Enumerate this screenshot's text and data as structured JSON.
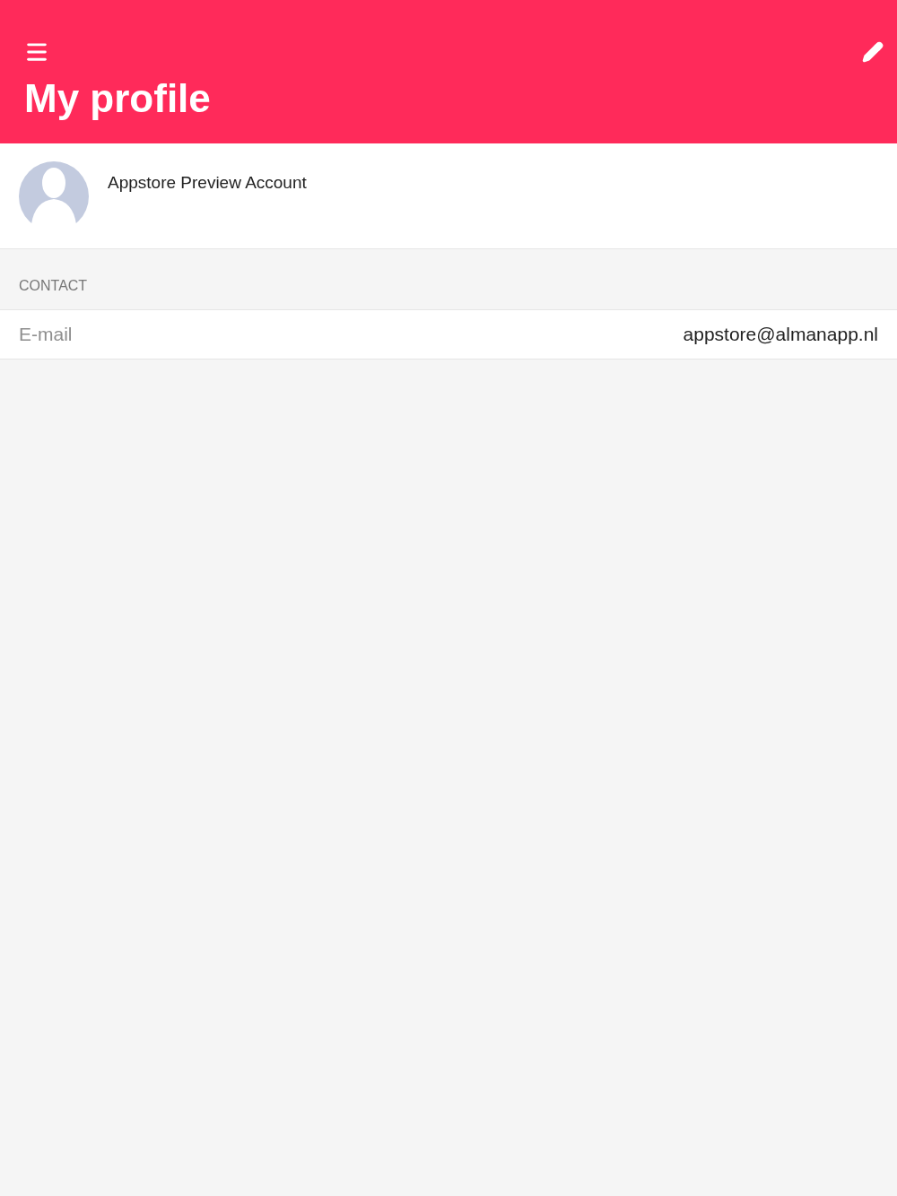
{
  "header": {
    "title": "My profile"
  },
  "profile": {
    "name": "Appstore Preview Account"
  },
  "sections": [
    {
      "title": "CONTACT",
      "rows": [
        {
          "label": "E-mail",
          "value": "appstore@almanapp.nl"
        }
      ]
    }
  ]
}
